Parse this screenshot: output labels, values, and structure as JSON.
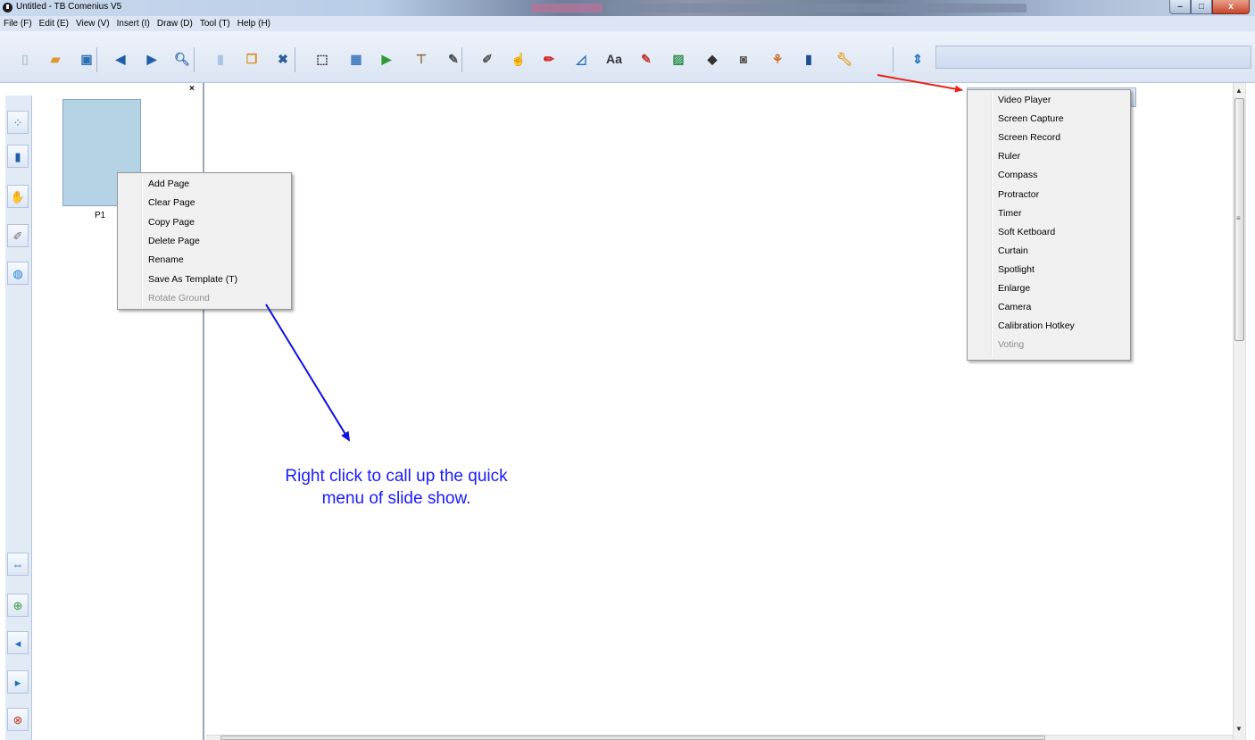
{
  "window": {
    "title": "Untitled - TB Comenius V5",
    "controls": {
      "minimize": "–",
      "maximize": "□",
      "close": "x"
    }
  },
  "menubar": {
    "items": [
      "File (F)",
      "Edit (E)",
      "View (V)",
      "Insert (I)",
      "Draw (D)",
      "Tool (T)",
      "Help (H)"
    ]
  },
  "toolbar": {
    "buttons": [
      {
        "name": "new-page",
        "icon": "blank-page-icon",
        "glyph": "▯",
        "color": "#b7c1cf"
      },
      {
        "name": "open",
        "icon": "folder-icon",
        "glyph": "▰",
        "color": "#d99a2b"
      },
      {
        "name": "save",
        "icon": "floppy-disk-icon",
        "glyph": "▣",
        "color": "#2d6fb6"
      },
      {
        "name": "previous",
        "icon": "arrow-left-icon",
        "glyph": "◀",
        "color": "#1e5fa8"
      },
      {
        "name": "next",
        "icon": "arrow-right-icon",
        "glyph": "▶",
        "color": "#1e5fa8"
      },
      {
        "name": "zoom",
        "icon": "magnifier-icon",
        "glyph": "🔍︎",
        "color": "#3a6fb0"
      },
      {
        "name": "page",
        "icon": "page-icon",
        "glyph": "▮",
        "color": "#a8c4e6"
      },
      {
        "name": "copy",
        "icon": "copy-page-icon",
        "glyph": "❐",
        "color": "#d98e1d"
      },
      {
        "name": "close-page",
        "icon": "close-circle-icon",
        "glyph": "✖",
        "color": "#2c5e9e"
      },
      {
        "name": "select-area",
        "icon": "select-area-icon",
        "glyph": "⬚",
        "color": "#333333"
      },
      {
        "name": "screen",
        "icon": "screen-icon",
        "glyph": "▦",
        "color": "#3f7bbf"
      },
      {
        "name": "play",
        "icon": "play-page-icon",
        "glyph": "▶",
        "color": "#2f9a3a"
      },
      {
        "name": "curtain",
        "icon": "curtain-icon",
        "glyph": "⊤",
        "color": "#8a6a3d"
      },
      {
        "name": "brush",
        "icon": "brush-icon",
        "glyph": "✎",
        "color": "#4a4a4a"
      },
      {
        "name": "pen",
        "icon": "pen-icon",
        "glyph": "✐",
        "color": "#555555"
      },
      {
        "name": "hand-select",
        "icon": "hand-select-icon",
        "glyph": "☝",
        "color": "#444444"
      },
      {
        "name": "red-pen",
        "icon": "red-pen-icon",
        "glyph": "✏",
        "color": "#d21f1f"
      },
      {
        "name": "ruler-triangle",
        "icon": "triangle-ruler-icon",
        "glyph": "◿",
        "color": "#2d6fb6"
      },
      {
        "name": "text",
        "icon": "text-box-icon",
        "glyph": "Aa",
        "color": "#333333"
      },
      {
        "name": "highlighter",
        "icon": "highlighter-icon",
        "glyph": "✎",
        "color": "#c0392b"
      },
      {
        "name": "image",
        "icon": "image-icon",
        "glyph": "▨",
        "color": "#2f8f4e"
      },
      {
        "name": "eraser",
        "icon": "eraser-icon",
        "glyph": "◆",
        "color": "#333333"
      },
      {
        "name": "camera",
        "icon": "camera-icon",
        "glyph": "◙",
        "color": "#555555"
      },
      {
        "name": "network",
        "icon": "network-icon",
        "glyph": "⚘",
        "color": "#c8702a"
      },
      {
        "name": "chart",
        "icon": "bar-chart-icon",
        "glyph": "▮",
        "color": "#1d4f8f"
      },
      {
        "name": "tools",
        "icon": "wrench-icon",
        "glyph": "🔧︎",
        "color": "#e89a1a"
      },
      {
        "name": "scroll",
        "icon": "vertical-arrows-icon",
        "glyph": "⇕",
        "color": "#1e6fc0"
      }
    ]
  },
  "leftbar": {
    "top_buttons": [
      {
        "name": "page-dots",
        "icon": "page-dots-icon",
        "glyph": "⁘",
        "color": "#3a6fb0"
      },
      {
        "name": "book",
        "icon": "book-icon",
        "glyph": "▮",
        "color": "#1f5ea8"
      },
      {
        "name": "hand-tools",
        "icon": "hand-tools-icon",
        "glyph": "✋",
        "color": "#c07a20"
      },
      {
        "name": "pen-tool",
        "icon": "pen-tool-icon",
        "glyph": "✐",
        "color": "#6a6a6a"
      },
      {
        "name": "globe",
        "icon": "globe-icon",
        "glyph": "◍",
        "color": "#1e7ed0"
      }
    ],
    "bottom_buttons": [
      {
        "name": "swap",
        "icon": "swap-arrows-icon",
        "glyph": "⇔",
        "color": "#1e6fc0"
      },
      {
        "name": "add-page",
        "icon": "add-page-icon",
        "glyph": "⊕",
        "color": "#2f9a3a"
      },
      {
        "name": "page-back",
        "icon": "page-back-icon",
        "glyph": "◂",
        "color": "#1e6fc0"
      },
      {
        "name": "page-forward",
        "icon": "page-forward-icon",
        "glyph": "▸",
        "color": "#1e6fc0"
      },
      {
        "name": "delete-page",
        "icon": "delete-page-icon",
        "glyph": "⊗",
        "color": "#c0392b"
      }
    ]
  },
  "page_panel": {
    "close_glyph": "×",
    "thumbnail_label": "P1"
  },
  "page_context_menu": {
    "items": [
      {
        "label": "Add Page",
        "enabled": true
      },
      {
        "label": "Clear Page",
        "enabled": true
      },
      {
        "label": "Copy Page",
        "enabled": true
      },
      {
        "label": "Delete Page",
        "enabled": true
      },
      {
        "label": "Rename",
        "enabled": true
      },
      {
        "label": "Save As Template (T)",
        "enabled": true
      },
      {
        "label": "Rotate Ground",
        "enabled": false
      }
    ]
  },
  "tools_menu": {
    "items": [
      {
        "label": "Video Player",
        "enabled": true
      },
      {
        "label": "Screen Capture",
        "enabled": true
      },
      {
        "label": "Screen Record",
        "enabled": true
      },
      {
        "label": "Ruler",
        "enabled": true
      },
      {
        "label": "Compass",
        "enabled": true
      },
      {
        "label": "Protractor",
        "enabled": true
      },
      {
        "label": "Timer",
        "enabled": true
      },
      {
        "label": "Soft Ketboard",
        "enabled": true
      },
      {
        "label": "Curtain",
        "enabled": true
      },
      {
        "label": "Spotlight",
        "enabled": true
      },
      {
        "label": "Enlarge",
        "enabled": true
      },
      {
        "label": "Camera",
        "enabled": true
      },
      {
        "label": "Calibration Hotkey",
        "enabled": true
      },
      {
        "label": "Voting",
        "enabled": false
      }
    ]
  },
  "annotation": {
    "line1": "Right click to call up the quick",
    "line2": "menu of slide show.",
    "color": "#1a1aff"
  },
  "colors": {
    "arrow_red": "#e8231a",
    "arrow_blue": "#1010e0"
  }
}
